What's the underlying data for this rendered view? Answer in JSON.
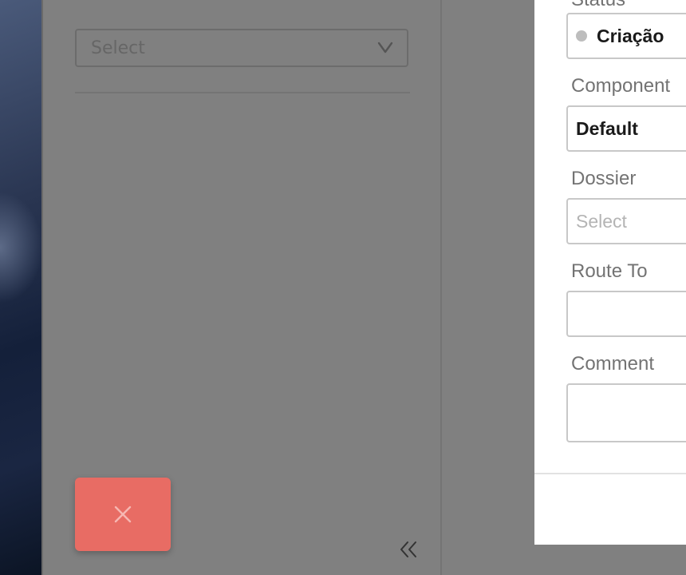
{
  "left_pane": {
    "select_placeholder": "Select",
    "close_icon": "close-icon",
    "collapse_icon": "double-chevron-left-icon"
  },
  "dialog": {
    "status": {
      "label": "Status",
      "value": "Criação"
    },
    "component": {
      "label": "Component",
      "value": "Default"
    },
    "dossier": {
      "label": "Dossier",
      "placeholder": "Select"
    },
    "route_to": {
      "label": "Route To",
      "value": ""
    },
    "comment": {
      "label": "Comment",
      "value": ""
    }
  },
  "colors": {
    "close_button": "#e86c64",
    "overlay_gray": "#808080",
    "status_dot": "#bdbdbd"
  }
}
